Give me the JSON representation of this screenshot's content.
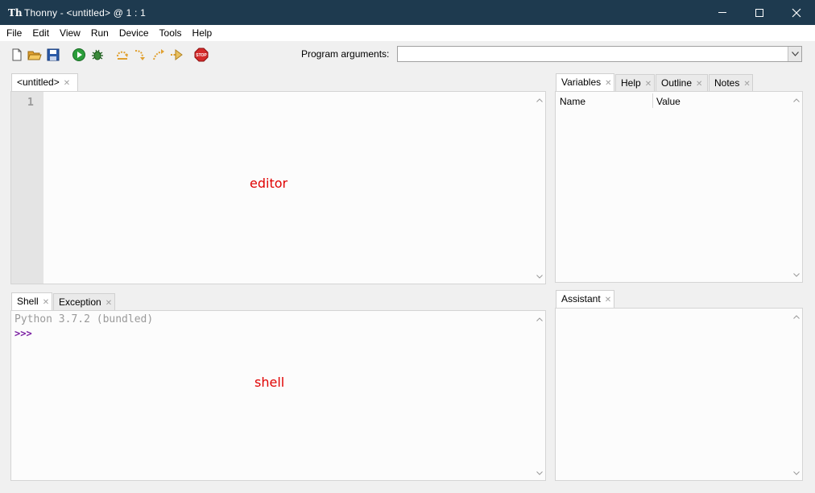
{
  "window": {
    "app_name": "Thonny",
    "title": "Thonny  -  <untitled>  @  1 : 1",
    "icon": "thonny-app-icon"
  },
  "menu": [
    "File",
    "Edit",
    "View",
    "Run",
    "Device",
    "Tools",
    "Help"
  ],
  "toolbar": {
    "buttons": [
      "new-file-icon",
      "open-file-icon",
      "save-icon",
      "run-icon",
      "debug-icon",
      "step-over-icon",
      "step-into-icon",
      "step-out-icon",
      "resume-icon",
      "stop-icon"
    ],
    "program_args_label": "Program arguments:",
    "program_args_value": ""
  },
  "editor": {
    "tab_label": "<untitled>",
    "line_numbers": [
      "1"
    ],
    "overlay_label": "editor"
  },
  "shell": {
    "tabs": [
      "Shell",
      "Exception"
    ],
    "lines": [
      "Python 3.7.2 (bundled)",
      ">>>"
    ],
    "overlay_label": "shell"
  },
  "sidebar": {
    "tabs": [
      "Variables",
      "Help",
      "Outline",
      "Notes"
    ],
    "columns": [
      "Name",
      "Value"
    ]
  },
  "assistant": {
    "tab_label": "Assistant"
  },
  "colors": {
    "titlebar": "#1e3a4f",
    "overlay_text": "#e00000",
    "prompt": "#7a1fa2",
    "banner": "#9a9a9a"
  }
}
